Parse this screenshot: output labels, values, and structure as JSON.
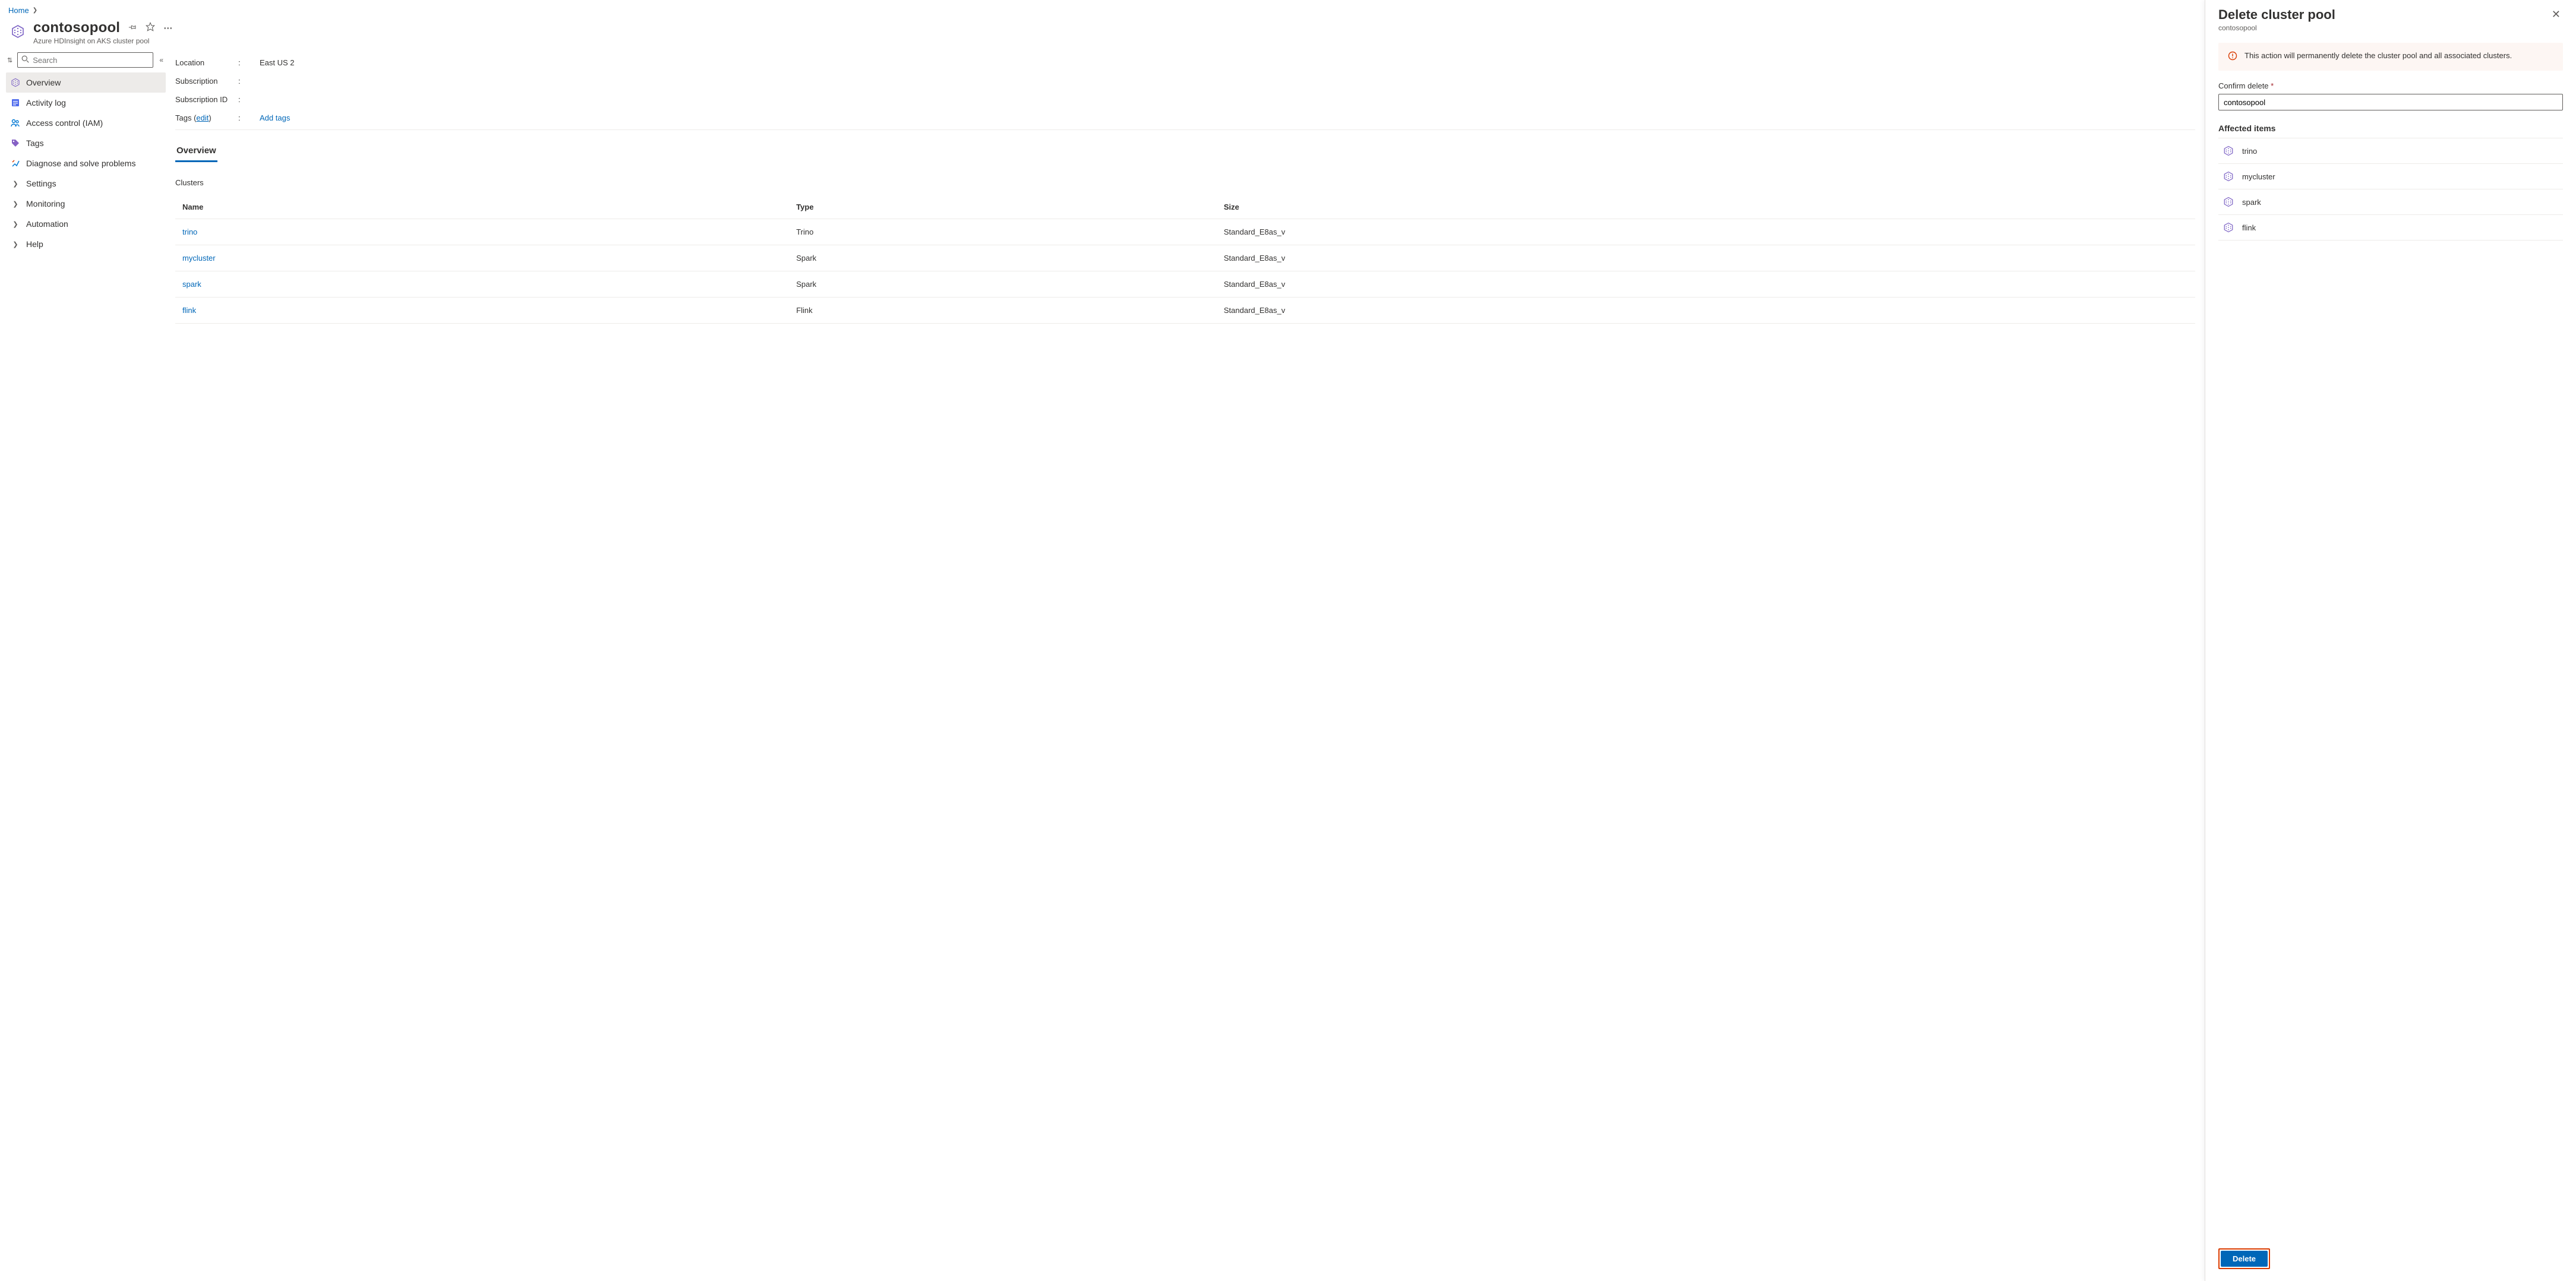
{
  "breadcrumb": {
    "home": "Home"
  },
  "header": {
    "title": "contosopool",
    "subtitle": "Azure HDInsight on AKS cluster pool",
    "more_aria": "More"
  },
  "search": {
    "placeholder": "Search"
  },
  "nav": {
    "overview": "Overview",
    "activity_log": "Activity log",
    "access_control": "Access control (IAM)",
    "tags": "Tags",
    "diagnose": "Diagnose and solve problems",
    "settings": "Settings",
    "monitoring": "Monitoring",
    "automation": "Automation",
    "help": "Help"
  },
  "essentials": {
    "location_label": "Location",
    "location_value": "East US 2",
    "subscription_label": "Subscription",
    "subscription_value": "",
    "subscription_id_label": "Subscription ID",
    "subscription_id_value": "",
    "tags_label": "Tags",
    "tags_edit": "edit",
    "add_tags": "Add tags"
  },
  "tabs": {
    "overview": "Overview"
  },
  "clusters": {
    "heading": "Clusters",
    "columns": {
      "name": "Name",
      "type": "Type",
      "size": "Size"
    },
    "rows": [
      {
        "name": "trino",
        "type": "Trino",
        "size": "Standard_E8as_v"
      },
      {
        "name": "mycluster",
        "type": "Spark",
        "size": "Standard_E8as_v"
      },
      {
        "name": "spark",
        "type": "Spark",
        "size": "Standard_E8as_v"
      },
      {
        "name": "flink",
        "type": "Flink",
        "size": "Standard_E8as_v"
      }
    ]
  },
  "panel": {
    "title": "Delete cluster pool",
    "subtitle": "contosopool",
    "warning": "This action will permanently delete the cluster pool and all associated clusters.",
    "confirm_label": "Confirm delete",
    "confirm_value": "contosopool",
    "affected_title": "Affected items",
    "affected": [
      "trino",
      "mycluster",
      "spark",
      "flink"
    ],
    "delete_button": "Delete"
  }
}
